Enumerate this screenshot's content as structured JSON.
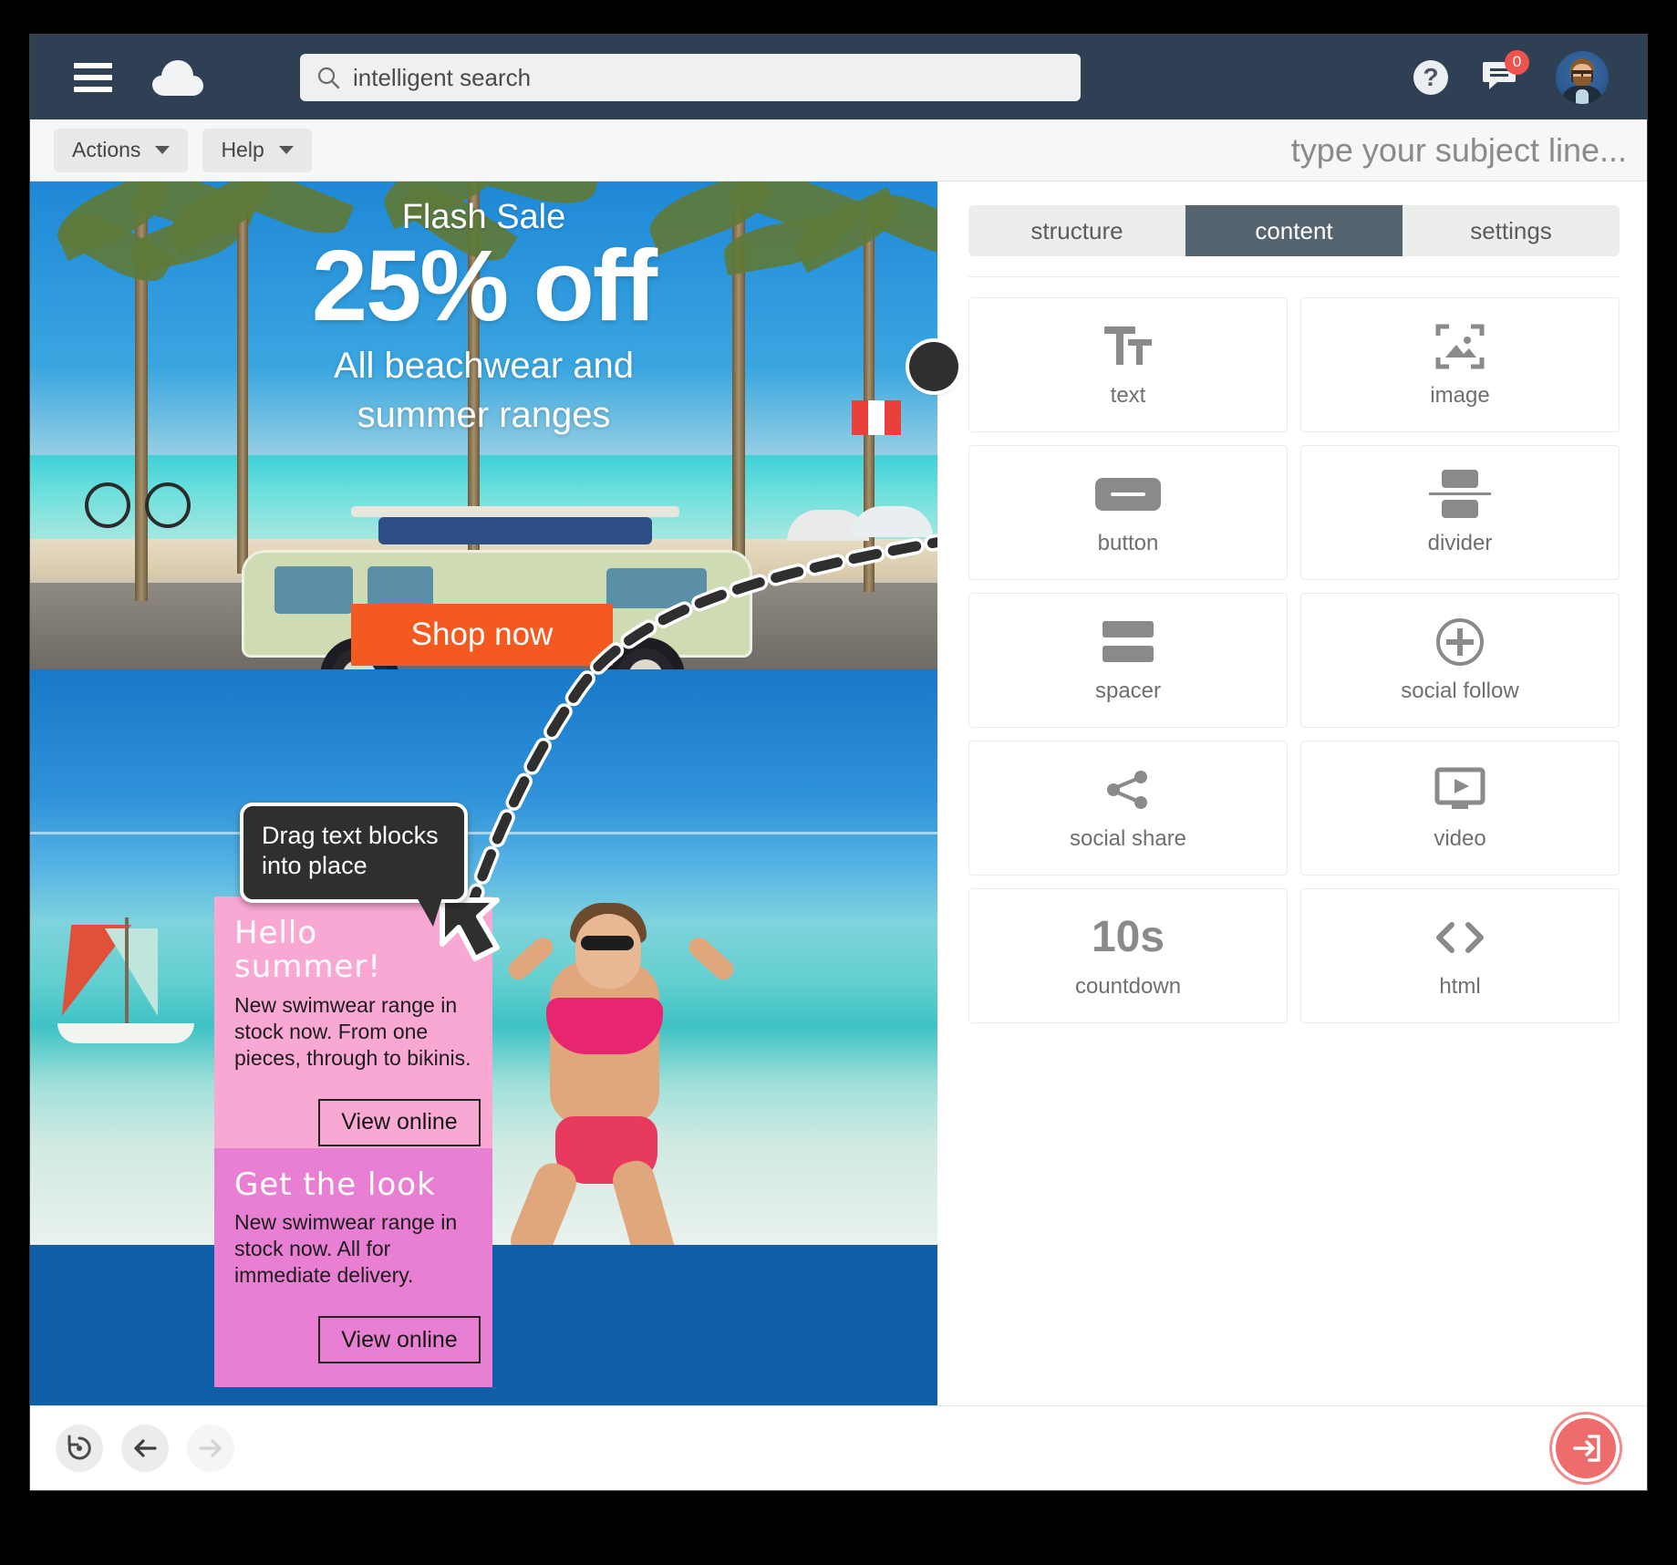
{
  "navbar": {
    "menu_icon": "hamburger-icon",
    "logo_icon": "cloud-logo-icon",
    "search": {
      "icon": "search-icon",
      "value": "intelligent search",
      "placeholder": "intelligent search"
    },
    "help_icon_label": "?",
    "messages": {
      "icon": "message-icon",
      "badge_count": "0"
    },
    "avatar_icon": "user-avatar"
  },
  "toolbar": {
    "actions_label": "Actions",
    "help_label": "Help",
    "subject_placeholder": "type your subject line..."
  },
  "panel": {
    "tabs": [
      {
        "label": "structure",
        "active": false
      },
      {
        "label": "content",
        "active": true
      },
      {
        "label": "settings",
        "active": false
      }
    ],
    "tiles": [
      {
        "label": "text",
        "icon": "text-icon"
      },
      {
        "label": "image",
        "icon": "image-icon"
      },
      {
        "label": "button",
        "icon": "button-icon"
      },
      {
        "label": "divider",
        "icon": "divider-icon"
      },
      {
        "label": "spacer",
        "icon": "spacer-icon"
      },
      {
        "label": "social follow",
        "icon": "social-follow-icon"
      },
      {
        "label": "social share",
        "icon": "social-share-icon"
      },
      {
        "label": "video",
        "icon": "video-icon"
      },
      {
        "label": "countdown",
        "icon": "countdown-icon",
        "icon_text": "10s"
      },
      {
        "label": "html",
        "icon": "html-icon"
      }
    ]
  },
  "email": {
    "hero": {
      "eyebrow": "Flash Sale",
      "headline": "25% off",
      "subhead_line1": "All beachwear and",
      "subhead_line2": "summer ranges",
      "cta_label": "Shop now",
      "cta_color": "#f4591f"
    },
    "tooltip": {
      "line1": "Drag text blocks",
      "line2": "into place"
    },
    "blocks": [
      {
        "title": "Hello summer!",
        "body": "New swimwear range in stock now. From one pieces, through to bikinis.",
        "button_label": "View online",
        "background": "#f9a8d4"
      },
      {
        "title": "Get the look",
        "body": "New swimwear range in stock now. All for immediate delivery.",
        "button_label": "View online",
        "background": "#e87fd2"
      }
    ]
  },
  "bottom_bar": {
    "revert_icon": "history-revert-icon",
    "back_icon": "arrow-left-icon",
    "forward_icon": "arrow-right-icon",
    "send_icon": "send-export-icon",
    "send_color": "#ef6c6c"
  }
}
